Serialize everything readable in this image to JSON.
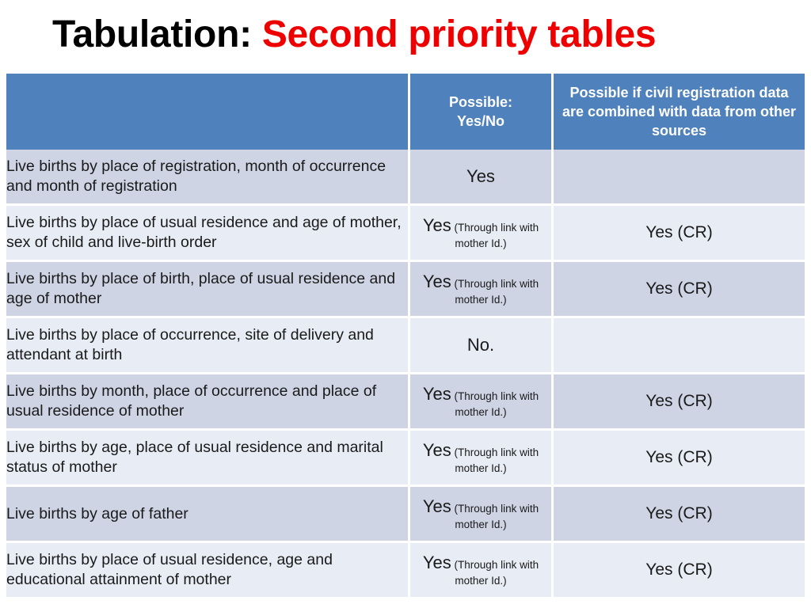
{
  "title": {
    "main": "Tabulation: ",
    "accent": "Second priority tables"
  },
  "colors": {
    "header_blue": "#4f81bd",
    "row_odd": "#ced4e4",
    "row_even": "#e8ecf4",
    "title_accent": "#ee0000",
    "title_main": "#000000",
    "grid_line": "#ffffff"
  },
  "table": {
    "headers": {
      "description": "",
      "possible": "Possible:\nYes/No",
      "possible_line1": "Possible:",
      "possible_line2": "Yes/No",
      "combined": "Possible if civil registration data are combined with data from other sources"
    },
    "rows": [
      {
        "description": "Live births by place of registration, month of occurrence and month of registration",
        "possible": "Yes",
        "possible_note": "",
        "combined": ""
      },
      {
        "description": "Live births by place of usual residence and age of mother, sex of child and live-birth order",
        "possible": "Yes",
        "possible_note": "(Through link with mother Id.)",
        "combined": "Yes (CR)"
      },
      {
        "description": "Live births by place of birth, place of usual residence and age of mother",
        "possible": "Yes",
        "possible_note": "(Through link with mother Id.)",
        "combined": "Yes (CR)"
      },
      {
        "description": "Live births by place of occurrence, site of delivery and attendant at birth",
        "possible": "No.",
        "possible_note": "",
        "combined": ""
      },
      {
        "description": "Live births by month, place of occurrence and place of usual residence of mother",
        "possible": "Yes",
        "possible_note": "(Through link with mother Id.)",
        "combined": "Yes (CR)"
      },
      {
        "description": "Live births by age, place of usual residence and marital status of mother",
        "possible": "Yes",
        "possible_note": "(Through link with mother Id.)",
        "combined": "Yes (CR)"
      },
      {
        "description": "Live births by age of father",
        "possible": "Yes",
        "possible_note": "(Through link with mother Id.)",
        "combined": "Yes (CR)"
      },
      {
        "description": "Live births by place of usual residence, age and educational attainment of mother",
        "possible": "Yes",
        "possible_note": "(Through link with mother Id.)",
        "combined": "Yes (CR)"
      }
    ]
  }
}
